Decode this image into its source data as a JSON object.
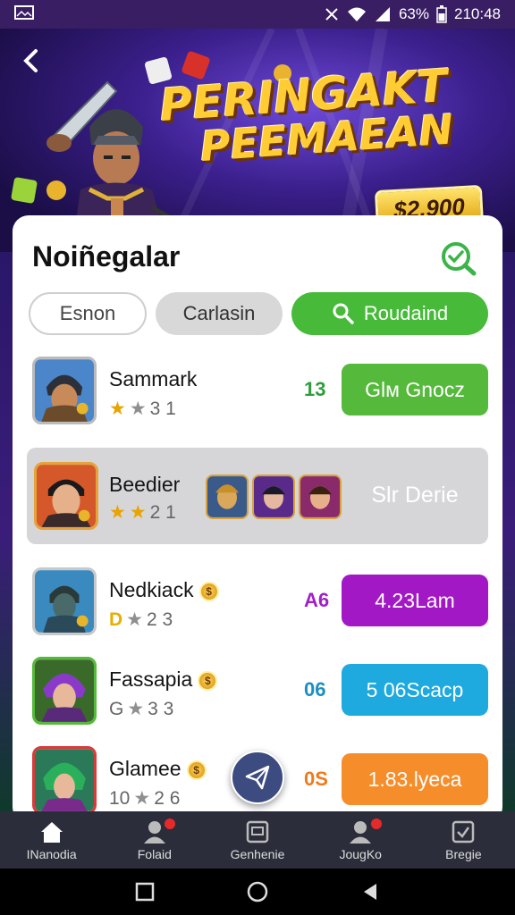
{
  "status_bar": {
    "battery": "63%",
    "time": "210:48"
  },
  "hero": {
    "title_line1": "PERINGAKT",
    "title_line2": "PEEMAEAN",
    "prize": "$2.900"
  },
  "card": {
    "title": "Noiñegalar",
    "tabs": [
      {
        "label": "Esnon"
      },
      {
        "label": "Carlasin"
      },
      {
        "label": "Roudaind"
      }
    ],
    "rows": [
      {
        "name": "Sammark",
        "rating": "3 1",
        "score": "13",
        "score_color": "#2e9e3c",
        "action": "Glм Gnocz",
        "action_color": "#55b93c",
        "prefix": ""
      },
      {
        "name": "Beedier",
        "rating": "2 1",
        "score": "",
        "action": "Slr Derie",
        "action_color": "transparent",
        "prefix": ""
      },
      {
        "name": "Nedkiack",
        "rating": "2 3",
        "score": "A6",
        "score_color": "#a020c8",
        "action": "4.23Lam",
        "action_color": "#a218c4",
        "prefix": "D"
      },
      {
        "name": "Fassapia",
        "rating": "3 3",
        "score": "06",
        "score_color": "#1a8fc0",
        "action": "5 06Scacp",
        "action_color": "#1ea9df",
        "prefix": "G"
      },
      {
        "name": "Glamee",
        "rating": "2 6",
        "score": "0S",
        "score_color": "#f07a1a",
        "action": "1.83.lyeca",
        "action_color": "#f58d2a",
        "prefix": "10"
      }
    ]
  },
  "bottom_nav": [
    {
      "label": "INanodia",
      "icon": "home-icon"
    },
    {
      "label": "Folaid",
      "icon": "user-icon"
    },
    {
      "label": "Genhenie",
      "icon": "gallery-icon"
    },
    {
      "label": "JougKo",
      "icon": "user-icon"
    },
    {
      "label": "Bregie",
      "icon": "shield-check-icon"
    }
  ],
  "colors": {
    "accent": "#47bb39",
    "hero_bg": "#3b1f8c",
    "nav_bg": "#2b2d3a"
  }
}
